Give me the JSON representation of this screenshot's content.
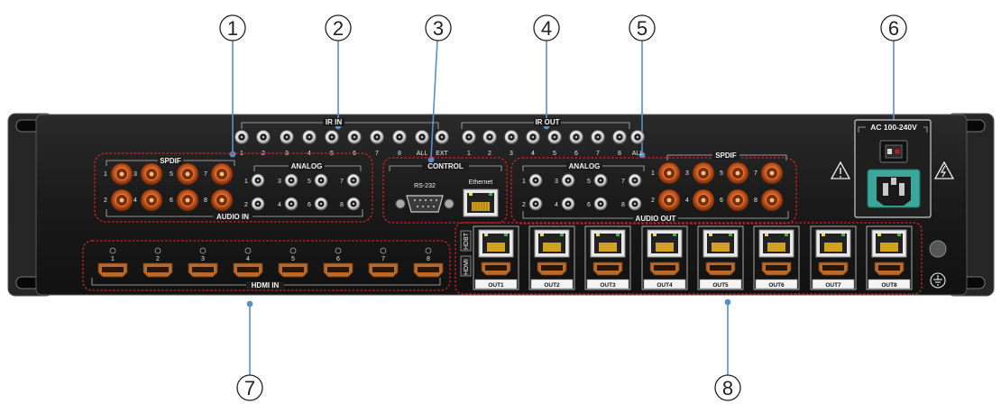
{
  "callouts": [
    "1",
    "2",
    "3",
    "4",
    "5",
    "6",
    "7",
    "8"
  ],
  "ir_in": {
    "title": "IR IN",
    "ports": [
      "1",
      "2",
      "3",
      "4",
      "5",
      "6",
      "7",
      "8",
      "ALL",
      "EXT"
    ]
  },
  "ir_out": {
    "title": "IR OUT",
    "ports": [
      "1",
      "2",
      "3",
      "4",
      "5",
      "6",
      "7",
      "8",
      "ALL"
    ]
  },
  "audio_in": {
    "title": "AUDIO IN",
    "spdif_title": "SPDIF",
    "spdif_numbers": [
      "1",
      "3",
      "5",
      "7",
      "2",
      "4",
      "6",
      "8"
    ],
    "analog_title": "ANALOG",
    "analog_numbers": [
      "1",
      "3",
      "5",
      "7",
      "2",
      "4",
      "6",
      "8"
    ]
  },
  "control": {
    "title": "CONTROL",
    "rs232": "RS-232",
    "ethernet": "Ethernet"
  },
  "audio_out": {
    "title": "AUDIO OUT",
    "analog_title": "ANALOG",
    "analog_numbers": [
      "1",
      "3",
      "5",
      "7",
      "2",
      "4",
      "6",
      "8"
    ],
    "spdif_title": "SPDIF",
    "spdif_numbers": [
      "1",
      "3",
      "5",
      "7",
      "2",
      "4",
      "6",
      "8"
    ]
  },
  "power": {
    "label": "AC 100-240V"
  },
  "hdmi_in": {
    "title": "HDMI IN",
    "ports": [
      "1",
      "2",
      "3",
      "4",
      "5",
      "6",
      "7",
      "8"
    ]
  },
  "outputs": {
    "hdbt_label": "HDBT",
    "hdmi_label": "HDMI",
    "ports": [
      "OUT1",
      "OUT2",
      "OUT3",
      "OUT4",
      "OUT5",
      "OUT6",
      "OUT7",
      "OUT8"
    ]
  },
  "colors": {
    "chassis": "#1b1b1b",
    "highlight": "#d62020",
    "leader": "#5b8fc4",
    "spdif": "#c8561e",
    "hdmi": "#b86a2c",
    "power_inlet": "#3aa79a"
  }
}
